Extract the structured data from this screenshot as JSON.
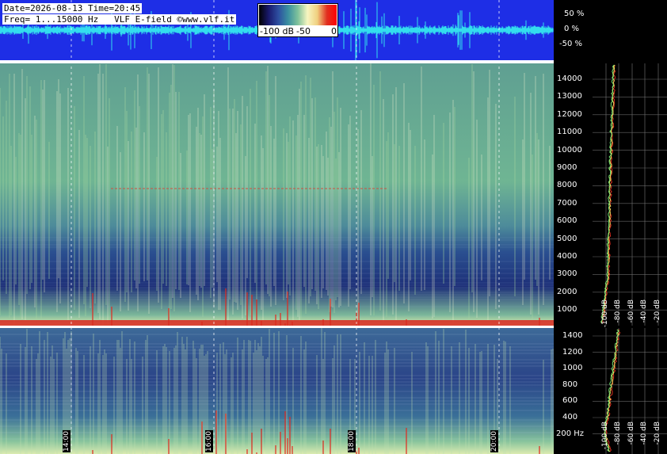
{
  "header": {
    "date_line": "Date=2026-08-13 Time=20:45",
    "freq_line": "Freq= 1...15000 Hz   VLF E-field ©www.vlf.it"
  },
  "colorbar": {
    "labels": [
      "-100 dB",
      "-50",
      "0"
    ],
    "stops": [
      "#000000",
      "#1a1a6e",
      "#2d4fa0",
      "#3a8fa0",
      "#7fc29b",
      "#f7f5c0",
      "#f0d080",
      "#e03020",
      "#ff0000"
    ]
  },
  "waveform": {
    "pct_labels": [
      "50 %",
      "0 %",
      "-50 %"
    ],
    "bg": "#1e2ee6",
    "trace": "#33ddee"
  },
  "spectrogram_top": {
    "freq_ticks": [
      "14000",
      "13000",
      "12000",
      "11000",
      "10000",
      "9000",
      "8000",
      "7000",
      "6000",
      "5000",
      "4000",
      "3000",
      "2000",
      "1000"
    ]
  },
  "spectrogram_bottom": {
    "freq_ticks": [
      "1400",
      "1200",
      "1000",
      "800",
      "600",
      "400",
      "200 Hz"
    ]
  },
  "time_labels": [
    "14:00",
    "16:00",
    "18:00",
    "20:00"
  ],
  "spectrum_db_labels": [
    "-100 dB",
    "-80 dB",
    "-60 dB",
    "-40 dB",
    "-20 dB"
  ],
  "chart_data": {
    "type": "heatmap",
    "title": "",
    "xlabel": "",
    "ylabel": "",
    "x_ticks": [
      "14:00",
      "16:00",
      "18:00",
      "20:00"
    ],
    "y_ticks_upper": [
      1000,
      2000,
      3000,
      4000,
      5000,
      6000,
      7000,
      8000,
      9000,
      10000,
      11000,
      12000,
      13000,
      14000
    ],
    "y_ticks_lower": [
      200,
      400,
      600,
      800,
      1000,
      1200,
      1400
    ],
    "ylim_upper": [
      1,
      15000
    ],
    "ylim_lower": [
      1,
      1500
    ],
    "colorbar_range_db": [
      -100,
      0
    ],
    "waveform_range_pct": [
      -50,
      50
    ],
    "spectrum_range_db": [
      -100,
      -20
    ]
  }
}
